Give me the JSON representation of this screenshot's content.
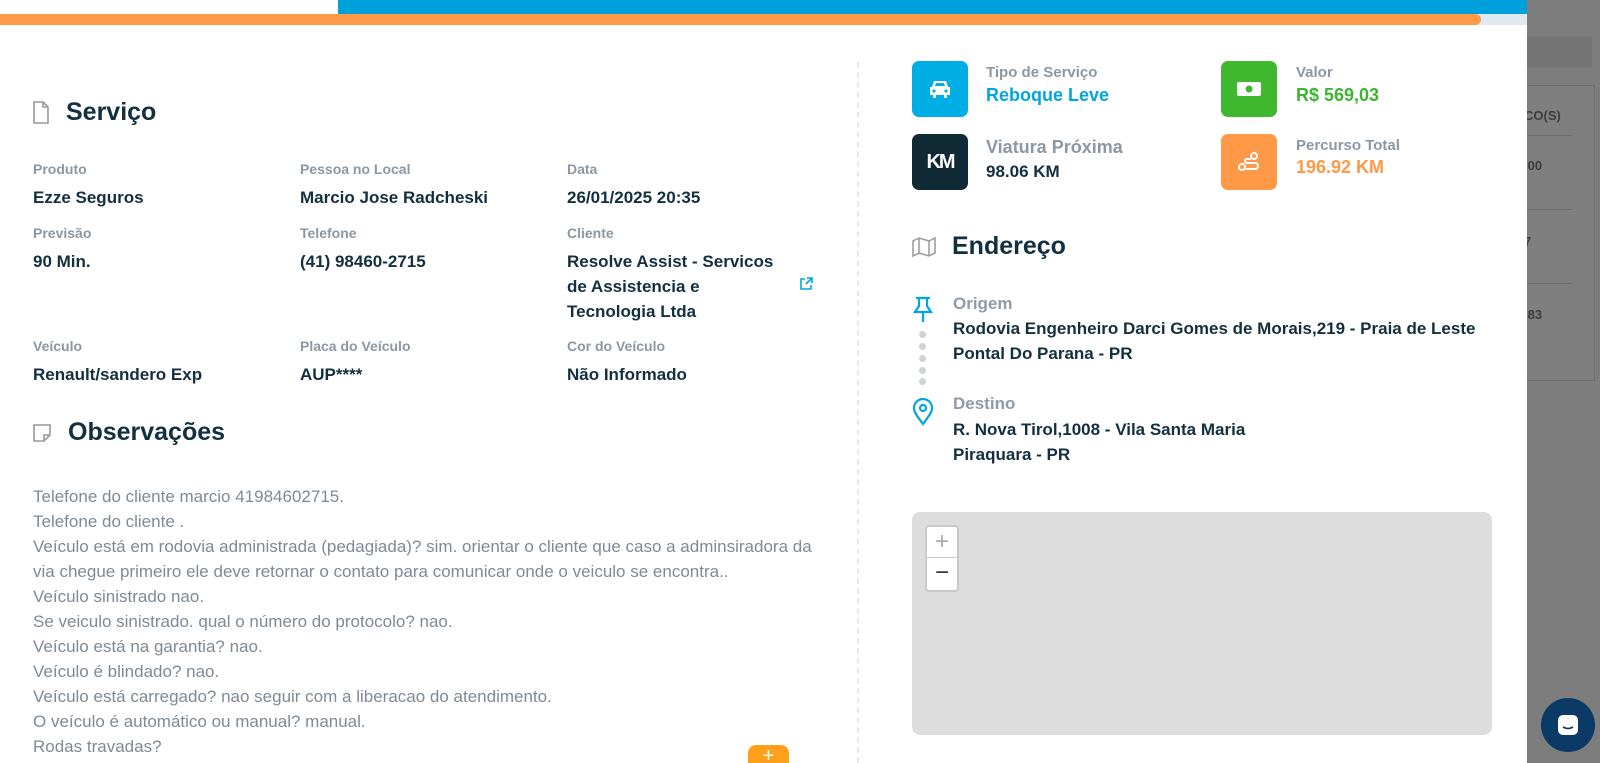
{
  "background": {
    "col_header": "CO(S)",
    "values": [
      ",00",
      "7",
      ",83"
    ]
  },
  "progress": {
    "fraction": 0.97
  },
  "servico": {
    "title": "Serviço",
    "fields": [
      {
        "label": "Produto",
        "value": "Ezze Seguros"
      },
      {
        "label": "Pessoa no Local",
        "value": "Marcio Jose Radcheski"
      },
      {
        "label": "Data",
        "value": "26/01/2025 20:35"
      },
      {
        "label": "Previsão",
        "value": "90 Min."
      },
      {
        "label": "Telefone",
        "value": "(41) 98460-2715"
      },
      {
        "label": "Cliente",
        "value": "Resolve Assist - Servicos de Assistencia e Tecnologia Ltda"
      },
      {
        "label": "Veículo",
        "value": "Renault/sandero Exp"
      },
      {
        "label": "Placa do Veículo",
        "value": "AUP****"
      },
      {
        "label": "Cor do Veículo",
        "value": "Não Informado"
      }
    ]
  },
  "observacoes": {
    "title": "Observações",
    "lines": [
      "Telefone do cliente marcio 41984602715.",
      "Telefone do cliente .",
      "Veículo está em rodovia administrada (pedagiada)? sim. orientar o cliente que caso a adminsiradora da via chegue primeiro ele deve retornar o contato para comunicar onde o veiculo se encontra..",
      "Veículo sinistrado nao.",
      "Se veiculo sinistrado. qual o número do protocolo? nao.",
      "Veículo está na garantia? nao.",
      "Veículo é blindado? nao.",
      "Veículo está carregado? nao seguir com a liberacao do atendimento.",
      "O veículo é automático ou manual? manual.",
      "Rodas travadas?"
    ],
    "add_label": "+"
  },
  "info": {
    "tipo": {
      "label": "Tipo de Serviço",
      "value": "Reboque Leve",
      "color": "#00a6dd"
    },
    "valor": {
      "label": "Valor",
      "value": "R$ 569,03",
      "color": "#3cb531"
    },
    "viatura": {
      "label": "Viatura Próxima",
      "value": "98.06 KM",
      "icon_text": "KM",
      "color": "#0f2a35"
    },
    "percurso": {
      "label": "Percurso Total",
      "value": "196.92 KM",
      "color": "#ff9847"
    }
  },
  "endereco": {
    "title": "Endereço",
    "origem": {
      "label": "Origem",
      "line1": "Rodovia Engenheiro Darci Gomes de Morais,219 - Praia de Leste",
      "line2": "Pontal Do Parana - PR"
    },
    "destino": {
      "label": "Destino",
      "line1": "R. Nova Tirol,1008 - Vila Santa Maria",
      "line2": "Piraquara - PR"
    }
  },
  "map": {
    "zoom_in": "+",
    "zoom_out": "−"
  }
}
